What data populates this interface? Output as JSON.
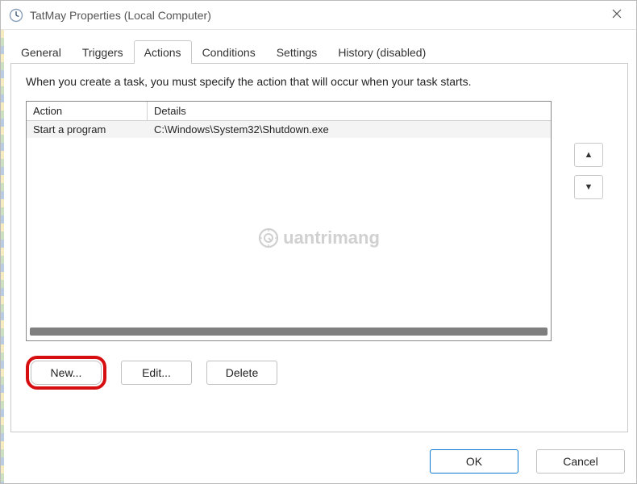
{
  "window": {
    "title": "TatMay Properties (Local Computer)"
  },
  "tabs": {
    "items": [
      {
        "label": "General"
      },
      {
        "label": "Triggers"
      },
      {
        "label": "Actions"
      },
      {
        "label": "Conditions"
      },
      {
        "label": "Settings"
      },
      {
        "label": "History (disabled)"
      }
    ],
    "active_index": 2
  },
  "actions_page": {
    "instruction": "When you create a task, you must specify the action that will occur when your task starts.",
    "columns": {
      "action": "Action",
      "details": "Details"
    },
    "rows": [
      {
        "action": "Start a program",
        "details": "C:\\Windows\\System32\\Shutdown.exe"
      }
    ],
    "buttons": {
      "new": "New...",
      "edit": "Edit...",
      "delete": "Delete"
    }
  },
  "footer": {
    "ok": "OK",
    "cancel": "Cancel"
  },
  "watermark": "uantrimang"
}
